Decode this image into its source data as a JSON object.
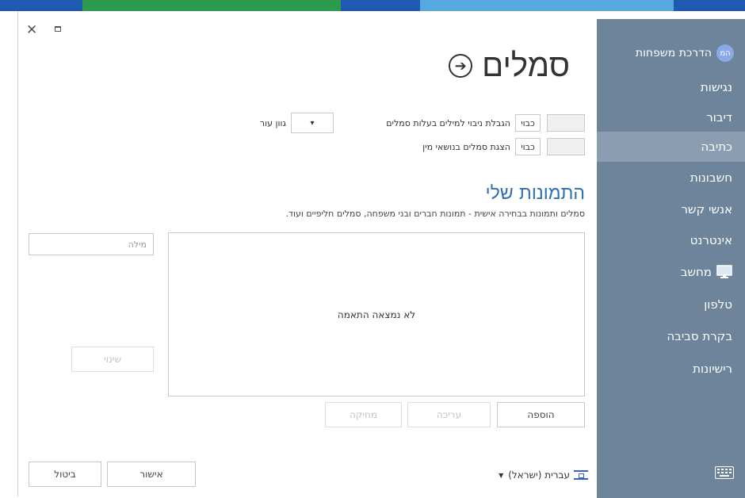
{
  "colors": {
    "sidebar": "#6e849a",
    "sidebar_active": "#8b9db0",
    "accent": "#2f6fb3",
    "topbar": [
      "#1e5ab0",
      "#2d9b4d",
      "#1e5ab0",
      "#58a8e0",
      "#1e5ab0"
    ]
  },
  "window": {
    "close_icon": "close-icon",
    "maximize_icon": "maximize-icon"
  },
  "sidebar": {
    "profile": {
      "avatar_text": "המ",
      "name": "הדרכת משפחות"
    },
    "items": [
      {
        "label": "נגישות"
      },
      {
        "label": "דיבור"
      },
      {
        "label": "כתיבה",
        "active": true
      },
      {
        "label": "חשבונות"
      },
      {
        "label": "אנשי קשר"
      },
      {
        "label": "אינטרנט"
      },
      {
        "label": "מחשב",
        "icon": "monitor-icon"
      },
      {
        "label": "טלפון"
      },
      {
        "label": "בקרת סביבה"
      },
      {
        "label": "רישיונות"
      }
    ],
    "keyboard_icon": "keyboard-icon"
  },
  "header": {
    "title": "סמלים",
    "back_icon": "arrow-circle-icon"
  },
  "settings": {
    "row1": {
      "label": "הגבלת ניבוי למילים בעלות סמלים",
      "state": "כבוי"
    },
    "row2": {
      "label": "הצגת סמלים בנושאי מין",
      "state": "כבוי"
    },
    "skin": {
      "label": "גוון עור",
      "value": ""
    }
  },
  "my_pictures": {
    "title": "התמונות שלי",
    "description": "סמלים ותמונות בבחירה אישית - תמונות חברים ובני משפחה, סמלים חליפיים ועוד.",
    "empty_message": "לא נמצאה התאמה",
    "search_placeholder": "מילה",
    "change_button": "שינוי",
    "add_button": "הוספה",
    "edit_button": "עריכה",
    "delete_button": "מחיקה"
  },
  "footer": {
    "language": "עברית (ישראל)",
    "ok_button": "אישור",
    "cancel_button": "ביטול"
  }
}
